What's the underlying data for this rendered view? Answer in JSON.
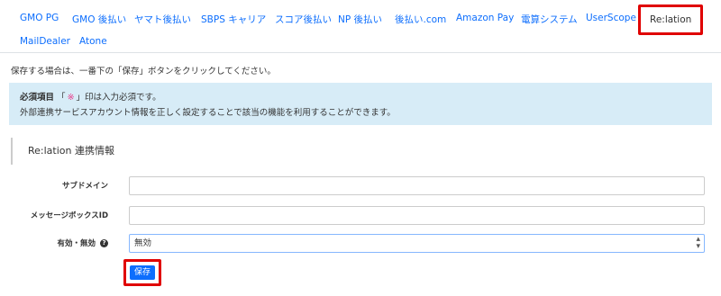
{
  "tabs": [
    {
      "label": "GMO PG"
    },
    {
      "label": "GMO 後払い"
    },
    {
      "label": "ヤマト後払い"
    },
    {
      "label": "SBPS キャリア"
    },
    {
      "label": "スコア後払い"
    },
    {
      "label": "NP 後払い"
    },
    {
      "label": "後払い.com"
    },
    {
      "label": "Amazon Pay"
    },
    {
      "label": "電算システム"
    },
    {
      "label": "UserScope"
    },
    {
      "label": "Re:lation"
    },
    {
      "label": "MailDealer"
    },
    {
      "label": "Atone"
    }
  ],
  "notice": "保存する場合は、一番下の「保存」ボタンをクリックしてください。",
  "alert": {
    "required_label": "必須項目",
    "required_open": "「",
    "required_mark": "※",
    "required_close": "」印は入力必須です。",
    "line2": "外部連携サービスアカウント情報を正しく設定することで該当の機能を利用することができます。"
  },
  "panel_title": "Re:lation 連携情報",
  "form": {
    "subdomain_label": "サブドメイン",
    "subdomain_value": "",
    "mailbox_label": "メッセージボックスID",
    "mailbox_value": "",
    "enabled_label": "有効・無効",
    "enabled_value": "無効",
    "help_glyph": "?"
  },
  "save_label": "保存"
}
